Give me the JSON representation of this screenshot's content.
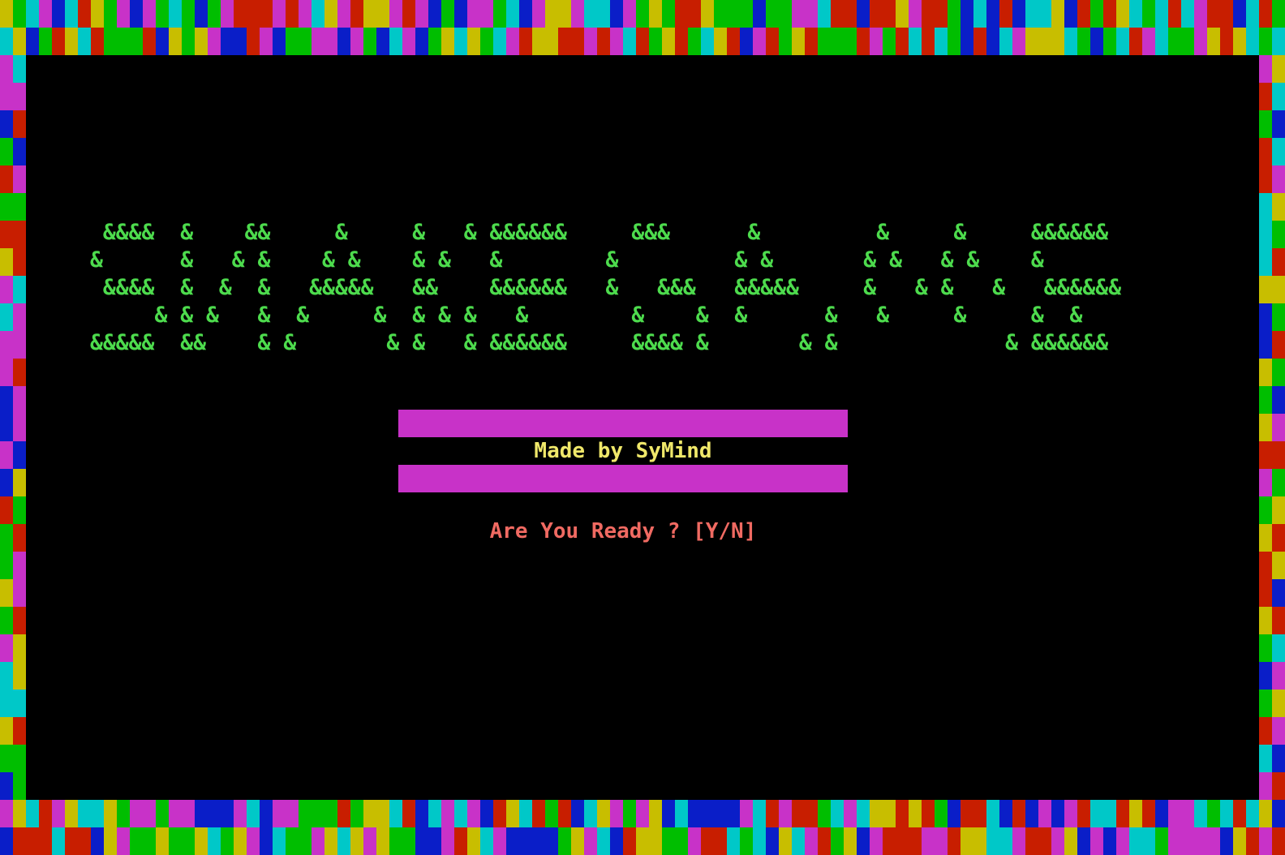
{
  "colors": {
    "background": "#000000",
    "logo": "#4ddb4d",
    "credit_text": "#f0e86a",
    "credit_bar": "#c832c8",
    "prompt": "#f06a62",
    "border_palette": [
      "#00c8c8",
      "#c832c8",
      "#c81e00",
      "#0a1ec8",
      "#c8be00",
      "#00be00"
    ]
  },
  "title_art": [
    " &&&&  &    &&     &     &   & &&&&&&     &&&      &         &     &     &&&&&&",
    "&      &   & &    & &    & &   &        &         & &       & &   & &    &",
    " &&&&  &  &  &   &&&&&   &&    &&&&&&   &   &&&   &&&&&     &   & &   &   &&&&&&",
    "     & & &   &  &     &  & & &   &        &    &  &      &   &     &     &  &",
    "&&&&&  &&    & &       & &   & &&&&&&     &&&& &       & &             & &&&&&&"
  ],
  "credit": "Made by SyMind",
  "prompt": "Are You Ready ? [Y/N]"
}
